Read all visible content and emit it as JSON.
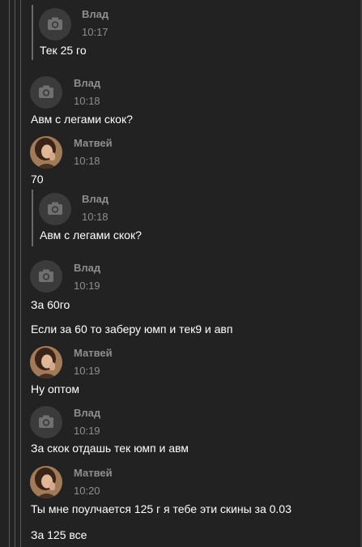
{
  "messages": [
    {
      "author": "Влад",
      "time": "10:17",
      "text": "Тек 25 го",
      "avatar_icon": "camera-icon",
      "quoted": true
    },
    {
      "author": "Влад",
      "time": "10:18",
      "text": "Авм с легами скок?",
      "avatar_icon": "camera-icon",
      "quoted": false
    },
    {
      "author": "Матвей",
      "time": "10:18",
      "text": "70",
      "avatar_icon": "user-photo",
      "quoted": false
    },
    {
      "author": "Влад",
      "time": "10:18",
      "text": "Авм с легами скок?",
      "avatar_icon": "camera-icon",
      "quoted": true
    },
    {
      "author": "Влад",
      "time": "10:19",
      "text": "За 60го",
      "extra_text": "Если за 60 то заберу юмп и тек9 и авп",
      "avatar_icon": "camera-icon",
      "quoted": false
    },
    {
      "author": "Матвей",
      "time": "10:19",
      "text": "Ну оптом",
      "avatar_icon": "user-photo",
      "quoted": false
    },
    {
      "author": "Влад",
      "time": "10:19",
      "text": "За скок отдашь тек юмп и авм",
      "avatar_icon": "camera-icon",
      "quoted": false
    },
    {
      "author": "Матвей",
      "time": "10:20",
      "text": "Ты мне поулчается 125 г я тебе эти скины за 0.03",
      "extra_text": "За 125 все",
      "avatar_icon": "user-photo",
      "quoted": false
    }
  ],
  "colors": {
    "background": "#222222",
    "meta_text": "#8e8e8e",
    "message_text": "#ffffff",
    "avatar_bg": "#3b3b3b"
  }
}
